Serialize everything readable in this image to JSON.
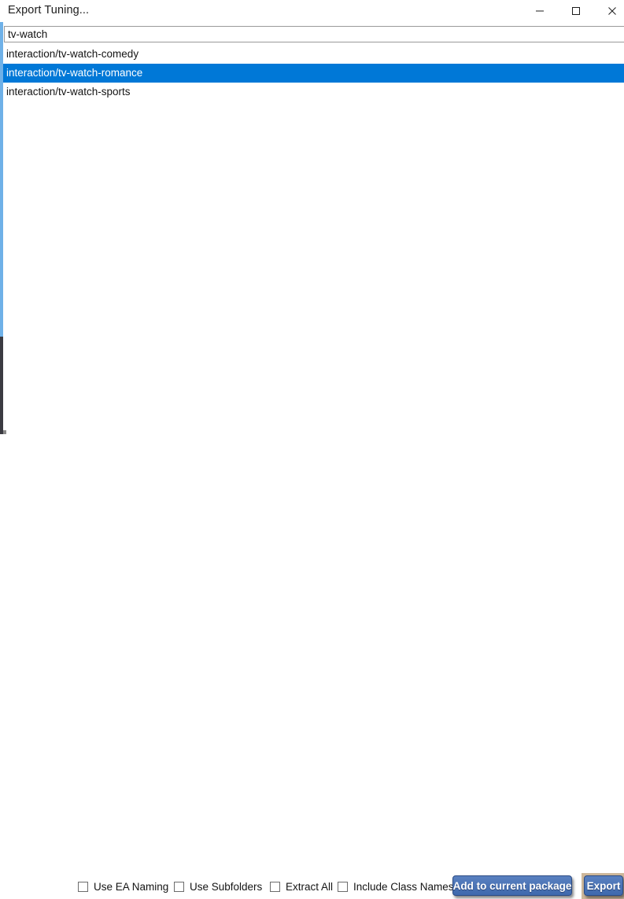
{
  "window": {
    "title": "Export Tuning...",
    "accent_color": "#0078d7",
    "button_color": "#4472b8",
    "edge_accent_color": "#6fb1e8"
  },
  "titlebar": {
    "minimize_label": "Minimize",
    "maximize_label": "Maximize",
    "close_label": "Close",
    "minimize_icon": "minimize-icon",
    "maximize_icon": "maximize-icon",
    "close_icon": "close-icon"
  },
  "search": {
    "value": "tv-watch",
    "placeholder": ""
  },
  "list": {
    "items": [
      {
        "label": "interaction/tv-watch-comedy",
        "selected": false
      },
      {
        "label": "interaction/tv-watch-romance",
        "selected": true
      },
      {
        "label": "interaction/tv-watch-sports",
        "selected": false
      }
    ]
  },
  "options": {
    "checkboxes": [
      {
        "label": "Use EA Naming",
        "checked": false
      },
      {
        "label": "Use Subfolders",
        "checked": false
      },
      {
        "label": "Extract All",
        "checked": false
      },
      {
        "label": "Include Class Names",
        "checked": false
      }
    ]
  },
  "actions": {
    "add_to_package_label": "Add to current package",
    "export_label": "Export"
  }
}
